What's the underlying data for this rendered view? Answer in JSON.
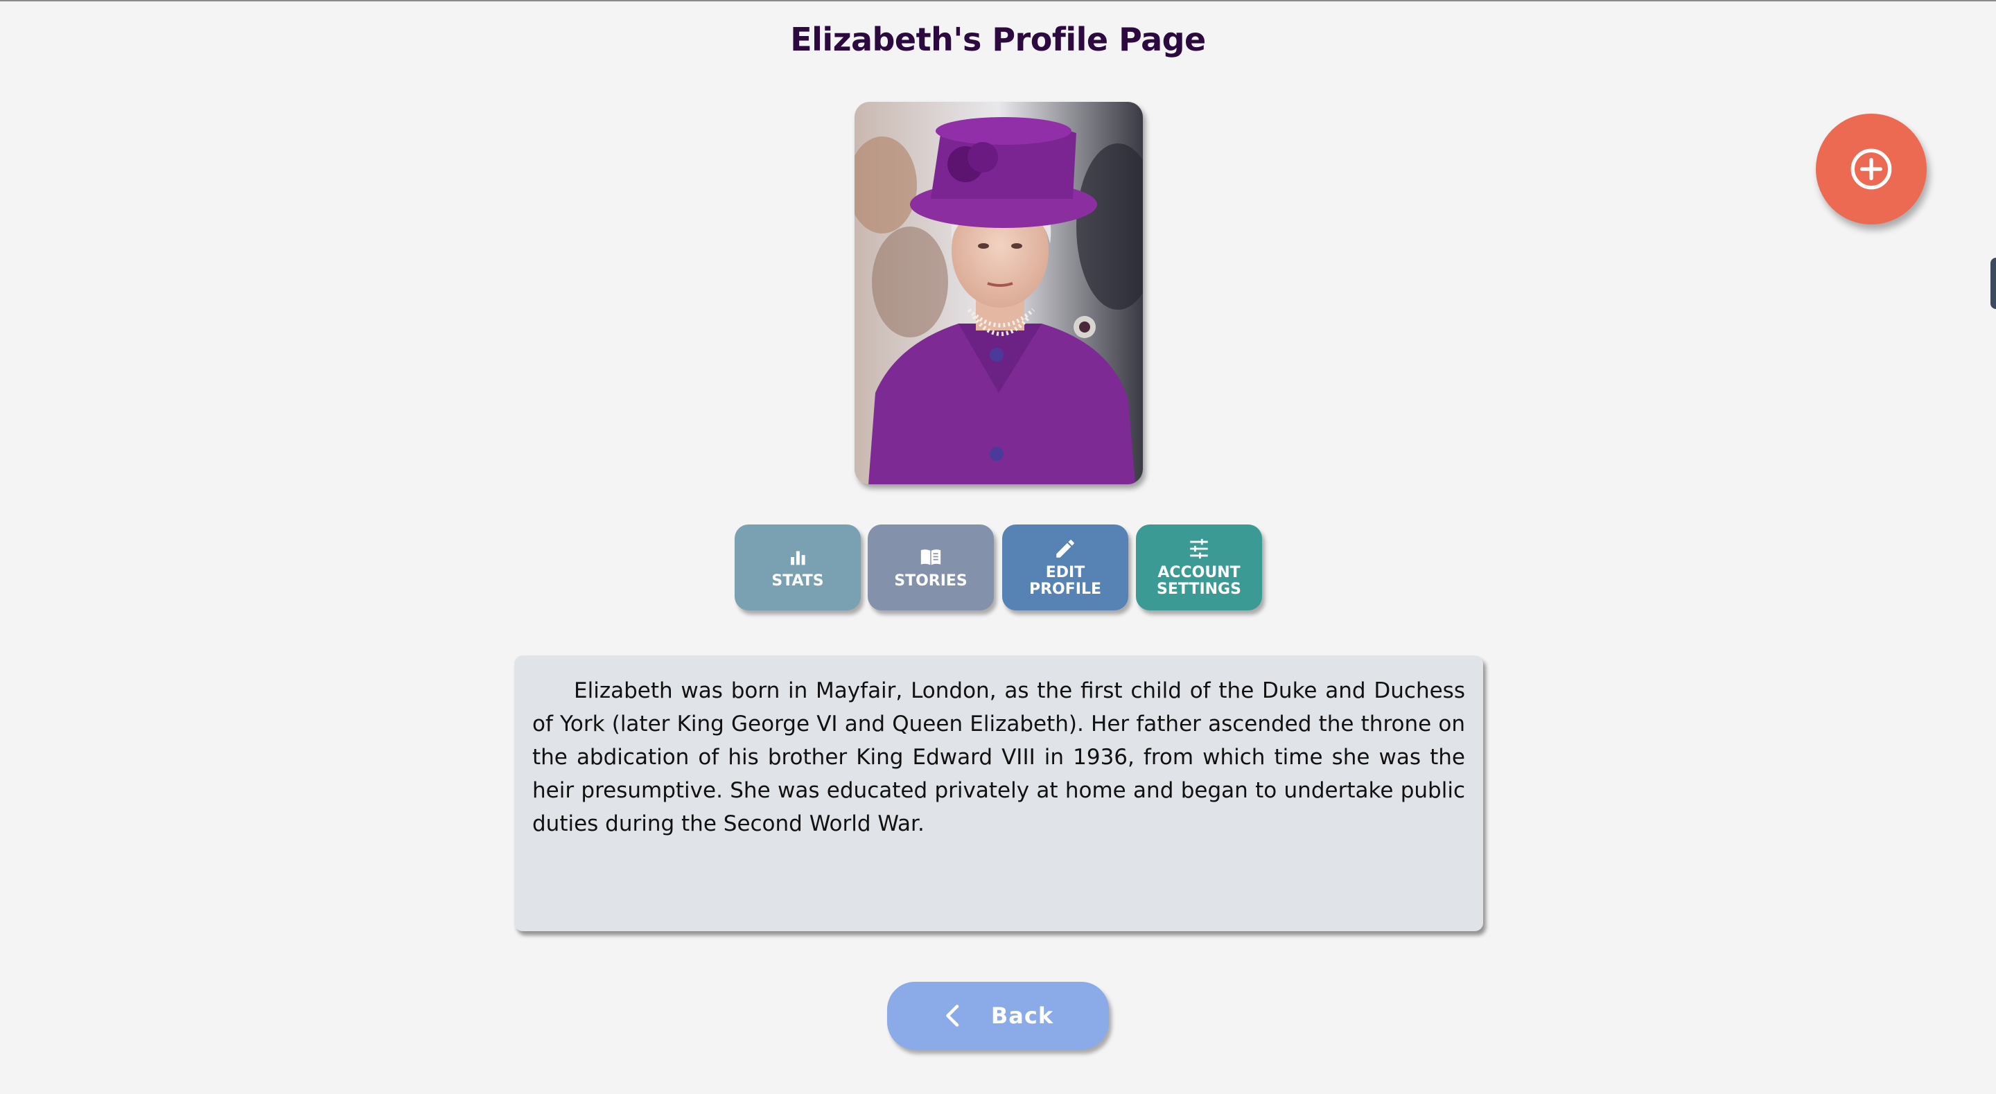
{
  "page": {
    "title": "Elizabeth's Profile Page"
  },
  "profile": {
    "photo_icon": "portrait-photo"
  },
  "fab": {
    "icon": "plus-circle-icon",
    "color": "#ec6a52"
  },
  "tabs": [
    {
      "label": "STATS",
      "icon": "bar-chart-icon",
      "color": "#7aa1b1"
    },
    {
      "label": "STORIES",
      "icon": "open-book-icon",
      "color": "#8391aa"
    },
    {
      "label": "EDIT\nPROFILE",
      "icon": "pencil-icon",
      "color": "#5783b4"
    },
    {
      "label": "ACCOUNT\nSETTINGS",
      "icon": "sliders-icon",
      "color": "#3c9a94"
    }
  ],
  "bio": {
    "text": "Elizabeth was born in Mayfair, London, as the first child of the Duke and Duchess of York (later King George VI and Queen Elizabeth). Her father ascended the throne on the abdication of his brother King Edward VIII in 1936, from which time she was the heir presumptive. She was educated privately at home and began to undertake public duties during the Second World War."
  },
  "back_button": {
    "label": "Back",
    "icon": "chevron-left-icon",
    "color": "#8aaae8"
  }
}
